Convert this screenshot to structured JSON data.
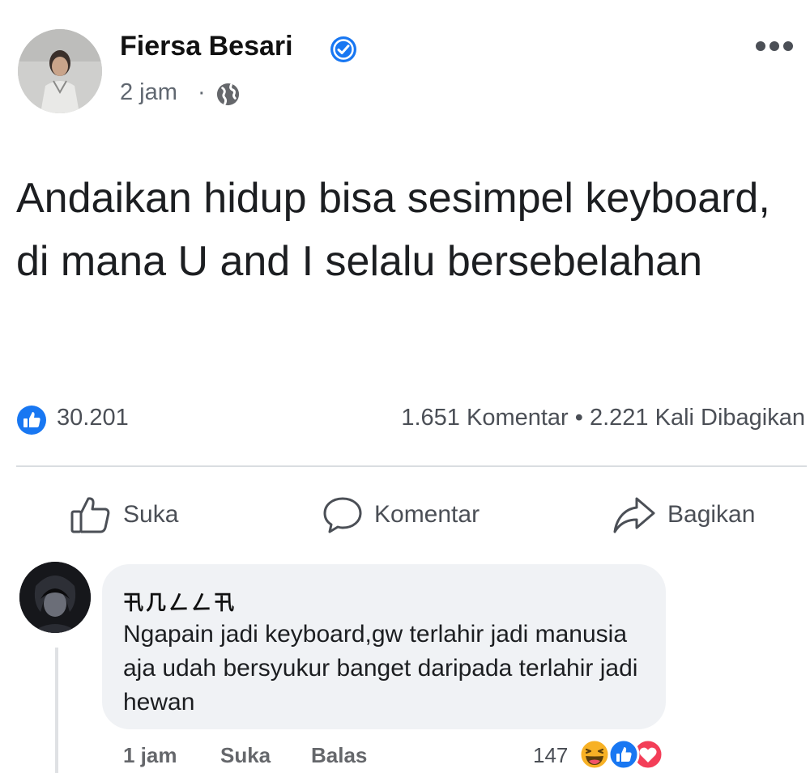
{
  "post": {
    "author": "Fiersa Besari",
    "time": "2 jam",
    "privacy_icon": "globe-icon",
    "text": "Andaikan hidup bisa sesimpel keyboard, di mana U and I selalu bersebelahan",
    "stats": {
      "reaction_count": "30.201",
      "comments_shares": "1.651 Komentar • 2.221 Kali Dibagikan"
    },
    "actions": {
      "like": "Suka",
      "comment": "Komentar",
      "share": "Bagikan"
    }
  },
  "comment": {
    "author": "卂几ㄥㄥ卂",
    "text": "Ngapain jadi keyboard,gw terlahir jadi manusia aja udah bersyukur banget daripada terlahir jadi hewan",
    "time": "1 jam",
    "like": "Suka",
    "reply": "Balas",
    "reaction_count": "147",
    "reaction_icons": [
      "haha-icon",
      "like-icon",
      "love-icon"
    ]
  },
  "colors": {
    "brand_blue": "#1877f2",
    "verified_blue": "#1877f2",
    "love_red": "#f33e58",
    "haha_yellow": "#f7b125"
  }
}
